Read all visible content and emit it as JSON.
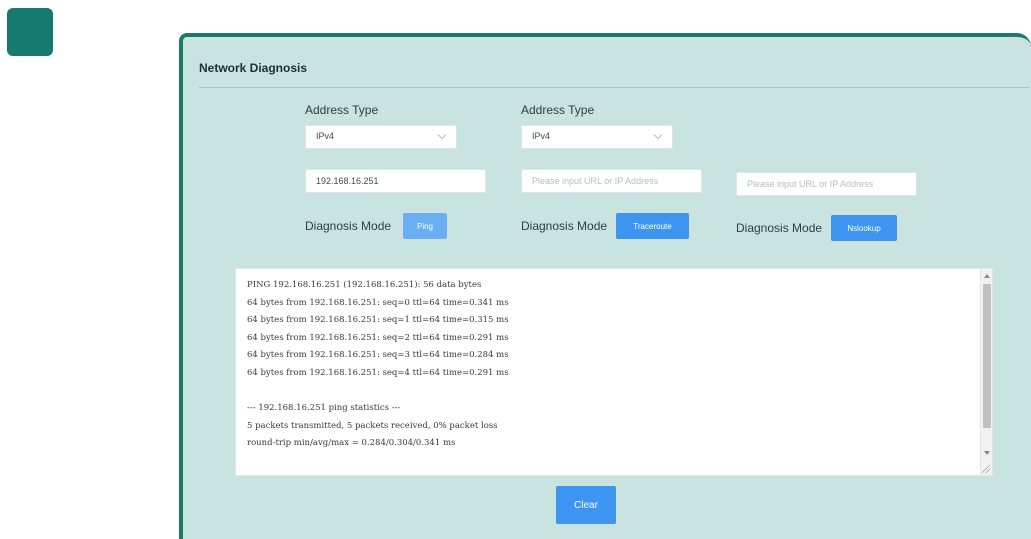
{
  "panel": {
    "title": "Network Diagnosis"
  },
  "ping": {
    "address_type_label": "Address Type",
    "address_type_value": "IPv4",
    "address_value": "192.168.16.251",
    "mode_label": "Diagnosis Mode",
    "button_label": "Ping"
  },
  "traceroute": {
    "address_type_label": "Address Type",
    "address_type_value": "IPv4",
    "address_placeholder": "Please input URL or IP Address",
    "mode_label": "Diagnosis Mode",
    "button_label": "Traceroute"
  },
  "nslookup": {
    "address_placeholder": "Please input URL or IP Address",
    "mode_label": "Diagnosis Mode",
    "button_label": "Nslookup"
  },
  "output": {
    "lines": [
      "PING 192.168.16.251 (192.168.16.251): 56 data bytes",
      "64 bytes from 192.168.16.251: seq=0 ttl=64 time=0.341 ms",
      "64 bytes from 192.168.16.251: seq=1 ttl=64 time=0.315 ms",
      "64 bytes from 192.168.16.251: seq=2 ttl=64 time=0.291 ms",
      "64 bytes from 192.168.16.251: seq=3 ttl=64 time=0.284 ms",
      "64 bytes from 192.168.16.251: seq=4 ttl=64 time=0.291 ms",
      "",
      "--- 192.168.16.251 ping statistics ---",
      "5 packets transmitted, 5 packets received, 0% packet loss",
      "round-trip min/avg/max = 0.284/0.304/0.341 ms"
    ]
  },
  "actions": {
    "clear_label": "Clear"
  },
  "colors": {
    "accent": "#3d95f0",
    "panel_bg": "#c8e3e0",
    "panel_border": "#1b7a6b",
    "app_tile": "#177a6e"
  }
}
